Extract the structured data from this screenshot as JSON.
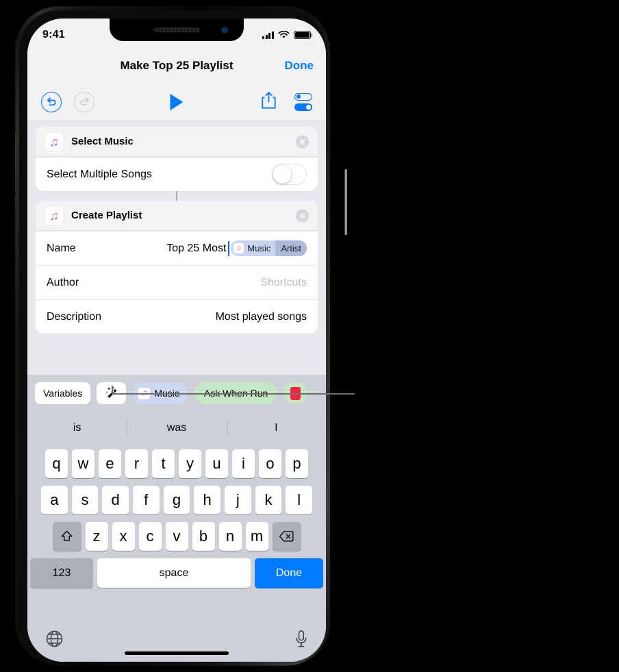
{
  "device": {
    "status_bar": {
      "time": "9:41",
      "signal_icon": "cellular-signal-icon",
      "wifi_icon": "wifi-icon",
      "battery_icon": "battery-full-icon"
    },
    "home_indicator": "home-indicator"
  },
  "navbar": {
    "title": "Make Top 25 Playlist",
    "done_label": "Done"
  },
  "toolbar": {
    "undo_icon": "undo-arrow-icon",
    "redo_icon": "redo-arrow-icon",
    "play_icon": "play-triangle-icon",
    "share_icon": "share-upload-icon",
    "settings_icon": "shortcut-settings-toggles-icon"
  },
  "actions": [
    {
      "app_icon": "apple-music-icon",
      "app_glyph": "♫",
      "title": "Select Music",
      "delete_icon": "close-circle-icon",
      "rows": [
        {
          "label": "Select Multiple Songs",
          "control": "toggle",
          "value": "off"
        }
      ]
    },
    {
      "app_icon": "apple-music-icon",
      "app_glyph": "♫",
      "title": "Create Playlist",
      "delete_icon": "close-circle-icon",
      "rows": [
        {
          "label": "Name",
          "control": "text-with-variable",
          "value": "Top 25 Most",
          "variable": {
            "icon": "apple-music-icon",
            "glyph": "♫",
            "name": "Music",
            "property": "Artist"
          }
        },
        {
          "label": "Author",
          "control": "text",
          "value": "",
          "placeholder": "Shortcuts"
        },
        {
          "label": "Description",
          "control": "text",
          "value": "Most played songs"
        }
      ]
    }
  ],
  "variable_bar": {
    "variables_label": "Variables",
    "magic_wand_icon": "magic-wand-icon",
    "magic_wand_glyph": "🪄",
    "chips": [
      {
        "type": "music",
        "icon": "apple-music-icon",
        "glyph": "♫",
        "label": "Music"
      },
      {
        "type": "green",
        "label": "Ask When Run"
      },
      {
        "type": "cut",
        "icon": "red-app-icon",
        "label": ""
      }
    ]
  },
  "predictive": {
    "suggestions": [
      "is",
      "was",
      "I"
    ]
  },
  "keyboard": {
    "row1": [
      "q",
      "w",
      "e",
      "r",
      "t",
      "y",
      "u",
      "i",
      "o",
      "p"
    ],
    "row2": [
      "a",
      "s",
      "d",
      "f",
      "g",
      "h",
      "j",
      "k",
      "l"
    ],
    "row3": [
      "z",
      "x",
      "c",
      "v",
      "b",
      "n",
      "m"
    ],
    "shift_icon": "shift-arrow-icon",
    "backspace_icon": "backspace-delete-icon",
    "numbers_label": "123",
    "space_label": "space",
    "return_label": "Done",
    "globe_icon": "globe-language-icon",
    "mic_icon": "microphone-dictation-icon"
  },
  "colors": {
    "accent_blue": "#007aff",
    "keyboard_bg": "#cdd0d6",
    "content_bg": "#e9e9ed",
    "variable_token": "#c9d4ef",
    "green_token": "#c6e7c6"
  },
  "callout": {
    "leader_line": "callout-leader-line-to-magic-wand"
  }
}
